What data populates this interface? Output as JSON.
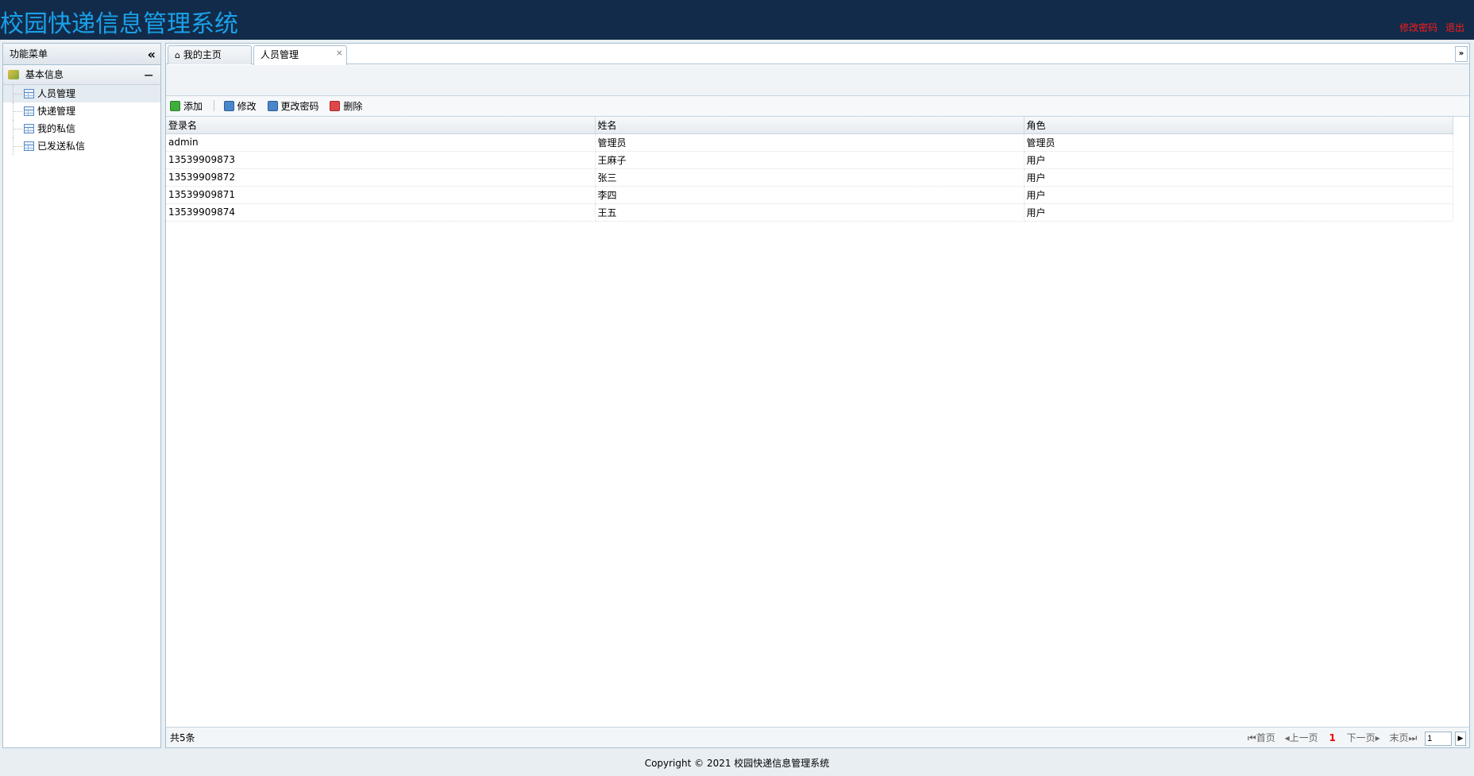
{
  "header": {
    "title": "校园快递信息管理系统",
    "links": [
      "修改密码",
      "退出"
    ]
  },
  "sidebar": {
    "title": "功能菜单",
    "collapse_glyph": "«",
    "group": {
      "label": "基本信息",
      "toggle": "−",
      "items": [
        {
          "label": "人员管理",
          "selected": true
        },
        {
          "label": "快递管理"
        },
        {
          "label": "我的私信"
        },
        {
          "label": "已发送私信"
        }
      ]
    }
  },
  "tabs": {
    "items": [
      {
        "label": "我的主页",
        "icon": "home-icon"
      },
      {
        "label": "人员管理",
        "closable": true,
        "active": true
      }
    ],
    "close_glyph": "×",
    "scroll_glyph": "»"
  },
  "toolbar": {
    "add_label": "添加",
    "edit_label": "修改",
    "change_password_label": "更改密码",
    "delete_label": "删除"
  },
  "grid": {
    "columns": [
      "登录名",
      "姓名",
      "角色"
    ],
    "rows": [
      [
        "admin",
        "管理员",
        "管理员"
      ],
      [
        "13539909873",
        "王麻子",
        "用户"
      ],
      [
        "13539909872",
        "张三",
        "用户"
      ],
      [
        "13539909871",
        "李四",
        "用户"
      ],
      [
        "13539909874",
        "王五",
        "用户"
      ]
    ]
  },
  "pager": {
    "total_text": "共5条",
    "first_label": "首页",
    "prev_label": "上一页",
    "current_page": "1",
    "next_label": "下一页",
    "last_label": "末页",
    "page_input_value": "1"
  },
  "footer": {
    "copyright": "Copyright © 2021 校园快递信息管理系统"
  },
  "colors": {
    "header_bg": "#122b4a",
    "title": "#1aa0e8",
    "header_links": "#ff1a1a"
  }
}
